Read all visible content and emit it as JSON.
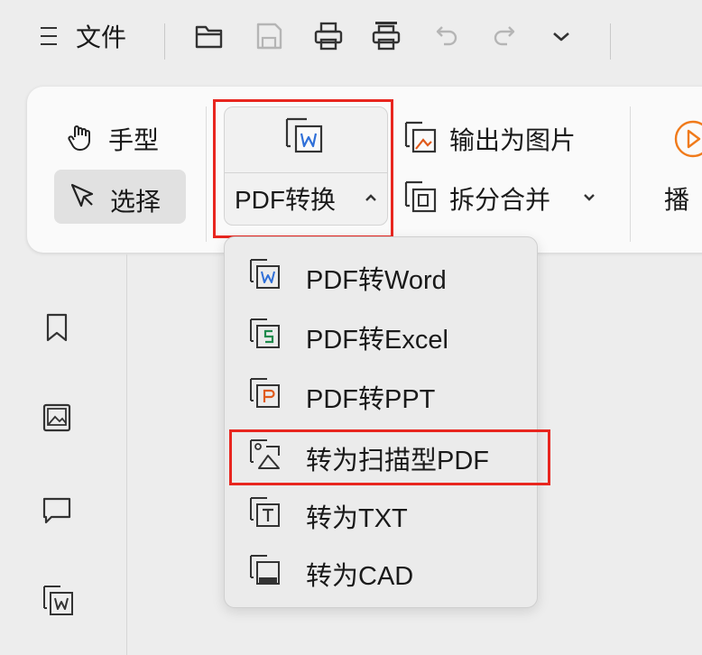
{
  "menu": {
    "file_label": "文件"
  },
  "ribbon": {
    "hand_label": "手型",
    "select_label": "选择",
    "convert_label": "PDF转换",
    "export_image_label": "输出为图片",
    "split_merge_label": "拆分合并",
    "play_label": "播"
  },
  "dropdown": {
    "items": [
      {
        "label": "PDF转Word",
        "icon": "word-file-icon"
      },
      {
        "label": "PDF转Excel",
        "icon": "excel-file-icon"
      },
      {
        "label": "PDF转PPT",
        "icon": "ppt-file-icon"
      },
      {
        "label": "转为扫描型PDF",
        "icon": "scan-image-icon"
      },
      {
        "label": "转为TXT",
        "icon": "txt-file-icon"
      },
      {
        "label": "转为CAD",
        "icon": "cad-file-icon"
      }
    ]
  },
  "colors": {
    "highlight_red": "#e8261f",
    "word_blue": "#2f6fd8",
    "excel_green": "#1f8a4c",
    "ppt_orange": "#e05a1b",
    "play_orange": "#f07a1a"
  }
}
